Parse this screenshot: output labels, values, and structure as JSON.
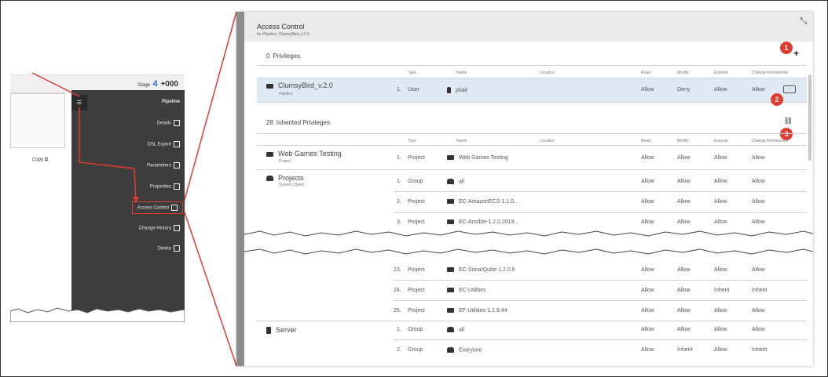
{
  "left": {
    "stage_label": "Stage",
    "stage_num": "4",
    "stage_code": "+000",
    "copy_label": "Copy",
    "menu": {
      "burger": "≡",
      "items": [
        {
          "label": "Pipeline"
        },
        {
          "label": "Details"
        },
        {
          "label": "DSL Export"
        },
        {
          "label": "Parameters"
        },
        {
          "label": "Properties"
        },
        {
          "label": "Access Control"
        },
        {
          "label": "Change History"
        },
        {
          "label": "Delete"
        }
      ]
    }
  },
  "dialog": {
    "close": "×",
    "title": "Access Control",
    "subtitle": "for Pipeline: ClumsyBird_v.2.0",
    "expand_icon": "⤡",
    "add_icon": "+",
    "unlink_icon": "⛓",
    "callouts": [
      "1",
      "2",
      "3"
    ],
    "privileges": {
      "count": "0",
      "label": "Privileges",
      "columns": [
        "Type",
        "Name",
        "Location",
        "Read",
        "Modify",
        "Execute",
        "Change Permissions"
      ],
      "rows": [
        {
          "object": "ClumsyBird_v.2.0",
          "object_type": "Pipeline",
          "num": "1.",
          "type": "User",
          "name": "phair",
          "location": "",
          "read": "Allow",
          "modify": "Deny",
          "execute": "Allow",
          "change": "Allow"
        }
      ]
    },
    "inherited": {
      "count": "28",
      "label": "Inherited Privileges",
      "columns": [
        "Type",
        "Name",
        "Location",
        "Read",
        "Modify",
        "Execute",
        "Change Permissions"
      ],
      "groups_top": [
        {
          "object": "Web Games Testing",
          "object_type": "Project",
          "rows": [
            {
              "num": "1.",
              "type": "Project",
              "name": "Web Games Testing",
              "read": "Allow",
              "modify": "Allow",
              "execute": "Allow",
              "change": "Allow"
            }
          ]
        },
        {
          "object": "Projects",
          "object_type": "System Object",
          "rows": [
            {
              "num": "1.",
              "type": "Group",
              "name": "all",
              "read": "Allow",
              "modify": "Allow",
              "execute": "Allow",
              "change": "Allow"
            },
            {
              "num": "2.",
              "type": "Project",
              "name": "EC-AmazonECS-1.1.0...",
              "read": "Allow",
              "modify": "Allow",
              "execute": "Allow",
              "change": "Allow"
            },
            {
              "num": "3.",
              "type": "Project",
              "name": "EC-Ansible-1.2.0.2019...",
              "read": "Allow",
              "modify": "Allow",
              "execute": "Allow",
              "change": "Allow"
            }
          ]
        }
      ],
      "rows_bottom": [
        {
          "num": "23.",
          "type": "Project",
          "name": "EC-SonarQube-1.2.0.0",
          "read": "Allow",
          "modify": "Allow",
          "execute": "Allow",
          "change": "Allow"
        },
        {
          "num": "24.",
          "type": "Project",
          "name": "EC-Utilities",
          "read": "Allow",
          "modify": "Allow",
          "execute": "Inherit",
          "change": "Inherit"
        },
        {
          "num": "25.",
          "type": "Project",
          "name": "EF-Utilities-1.1.9.44",
          "read": "Allow",
          "modify": "Allow",
          "execute": "Allow",
          "change": "Allow"
        }
      ],
      "server_group": {
        "object": "Server",
        "rows": [
          {
            "num": "1.",
            "type": "Group",
            "name": "all",
            "read": "Allow",
            "modify": "Allow",
            "execute": "Allow",
            "change": "Allow"
          },
          {
            "num": "2.",
            "type": "Group",
            "name": "Everyone",
            "read": "Allow",
            "modify": "Inherit",
            "execute": "Allow",
            "change": "Inherit"
          }
        ]
      }
    }
  },
  "colors": {
    "accent_red": "#e23b30",
    "stage_blue": "#2a6cd0",
    "menu_dark": "#3d3d3d",
    "highlight_row": "#dfe9f3"
  }
}
